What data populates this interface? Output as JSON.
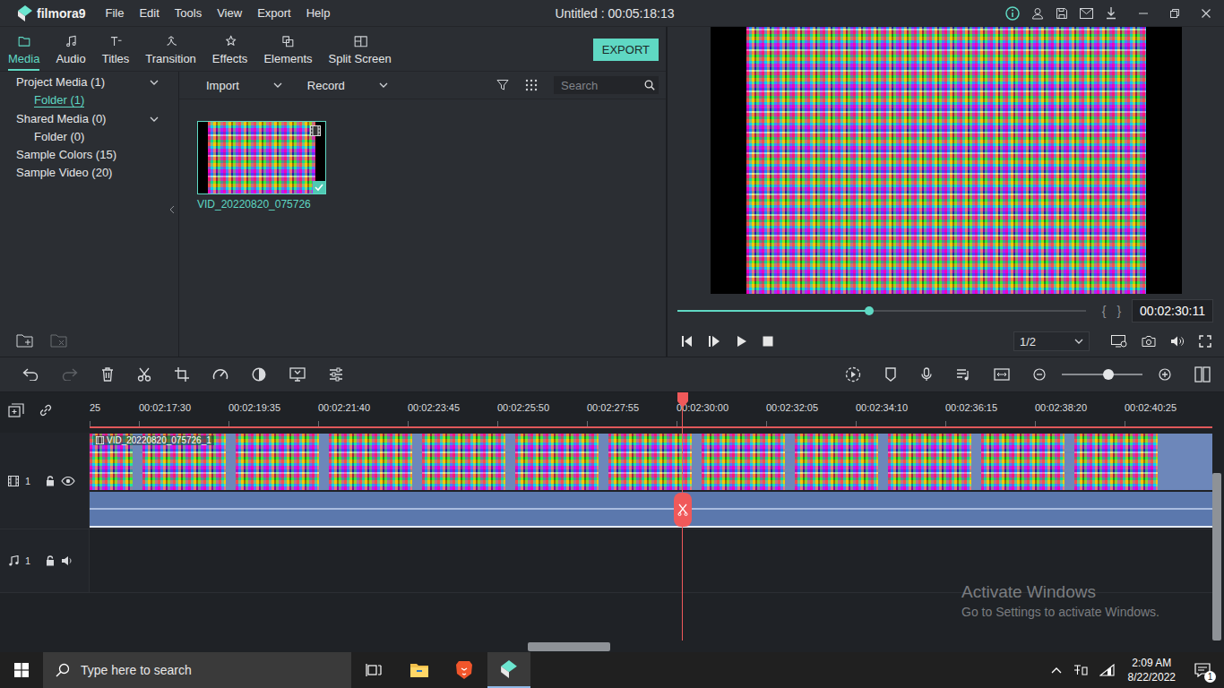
{
  "window": {
    "app": "filmora9",
    "title": "Untitled : 00:05:18:13"
  },
  "menu": [
    "File",
    "Edit",
    "Tools",
    "View",
    "Export",
    "Help"
  ],
  "tabs": [
    {
      "label": "Media",
      "selected": true
    },
    {
      "label": "Audio",
      "selected": false
    },
    {
      "label": "Titles",
      "selected": false
    },
    {
      "label": "Transition",
      "selected": false
    },
    {
      "label": "Effects",
      "selected": false
    },
    {
      "label": "Elements",
      "selected": false
    },
    {
      "label": "Split Screen",
      "selected": false
    }
  ],
  "export_button": "EXPORT",
  "sidebar": {
    "items": [
      {
        "label": "Project Media (1)",
        "kind": "group",
        "expanded": true,
        "selected": false
      },
      {
        "label": "Folder (1)",
        "kind": "folder",
        "expanded": false,
        "selected": true
      },
      {
        "label": "Shared Media (0)",
        "kind": "group",
        "expanded": true,
        "selected": false
      },
      {
        "label": "Folder (0)",
        "kind": "folder",
        "expanded": false,
        "selected": false
      },
      {
        "label": "Sample Colors (15)",
        "kind": "item",
        "expanded": false,
        "selected": false
      },
      {
        "label": "Sample Video (20)",
        "kind": "item",
        "expanded": false,
        "selected": false
      }
    ]
  },
  "media_toolbar": {
    "import": "Import",
    "record": "Record",
    "search_placeholder": "Search"
  },
  "media_items": [
    {
      "name": "VID_20220820_075726",
      "selected": true
    }
  ],
  "preview": {
    "progress": 0.47,
    "mark_in": "{",
    "mark_out": "}",
    "time": "00:02:30:11",
    "quality": "1/2"
  },
  "edit_tools": {
    "undo_disabled": false,
    "redo_disabled": true
  },
  "zoom": {
    "level": 0.58
  },
  "timeline": {
    "ruler": [
      "25",
      "00:02:17:30",
      "00:02:19:35",
      "00:02:21:40",
      "00:02:23:45",
      "00:02:25:50",
      "00:02:27:55",
      "00:02:30:00",
      "00:02:32:05",
      "00:02:34:10",
      "00:02:36:15",
      "00:02:38:20",
      "00:02:40:25"
    ],
    "playhead": 0.528,
    "scroll": 0.39
  },
  "tracks": [
    {
      "kind": "video",
      "number": "1",
      "locked": false,
      "visible": true,
      "clip": "VID_20220820_075726_1"
    },
    {
      "kind": "audio",
      "number": "1",
      "locked": false,
      "muted": false
    }
  ],
  "watermark": {
    "title": "Activate Windows",
    "subtitle": "Go to Settings to activate Windows."
  },
  "taskbar": {
    "search_placeholder": "Type here to search",
    "time": "2:09 AM",
    "date": "8/22/2022",
    "notifications": "1"
  }
}
